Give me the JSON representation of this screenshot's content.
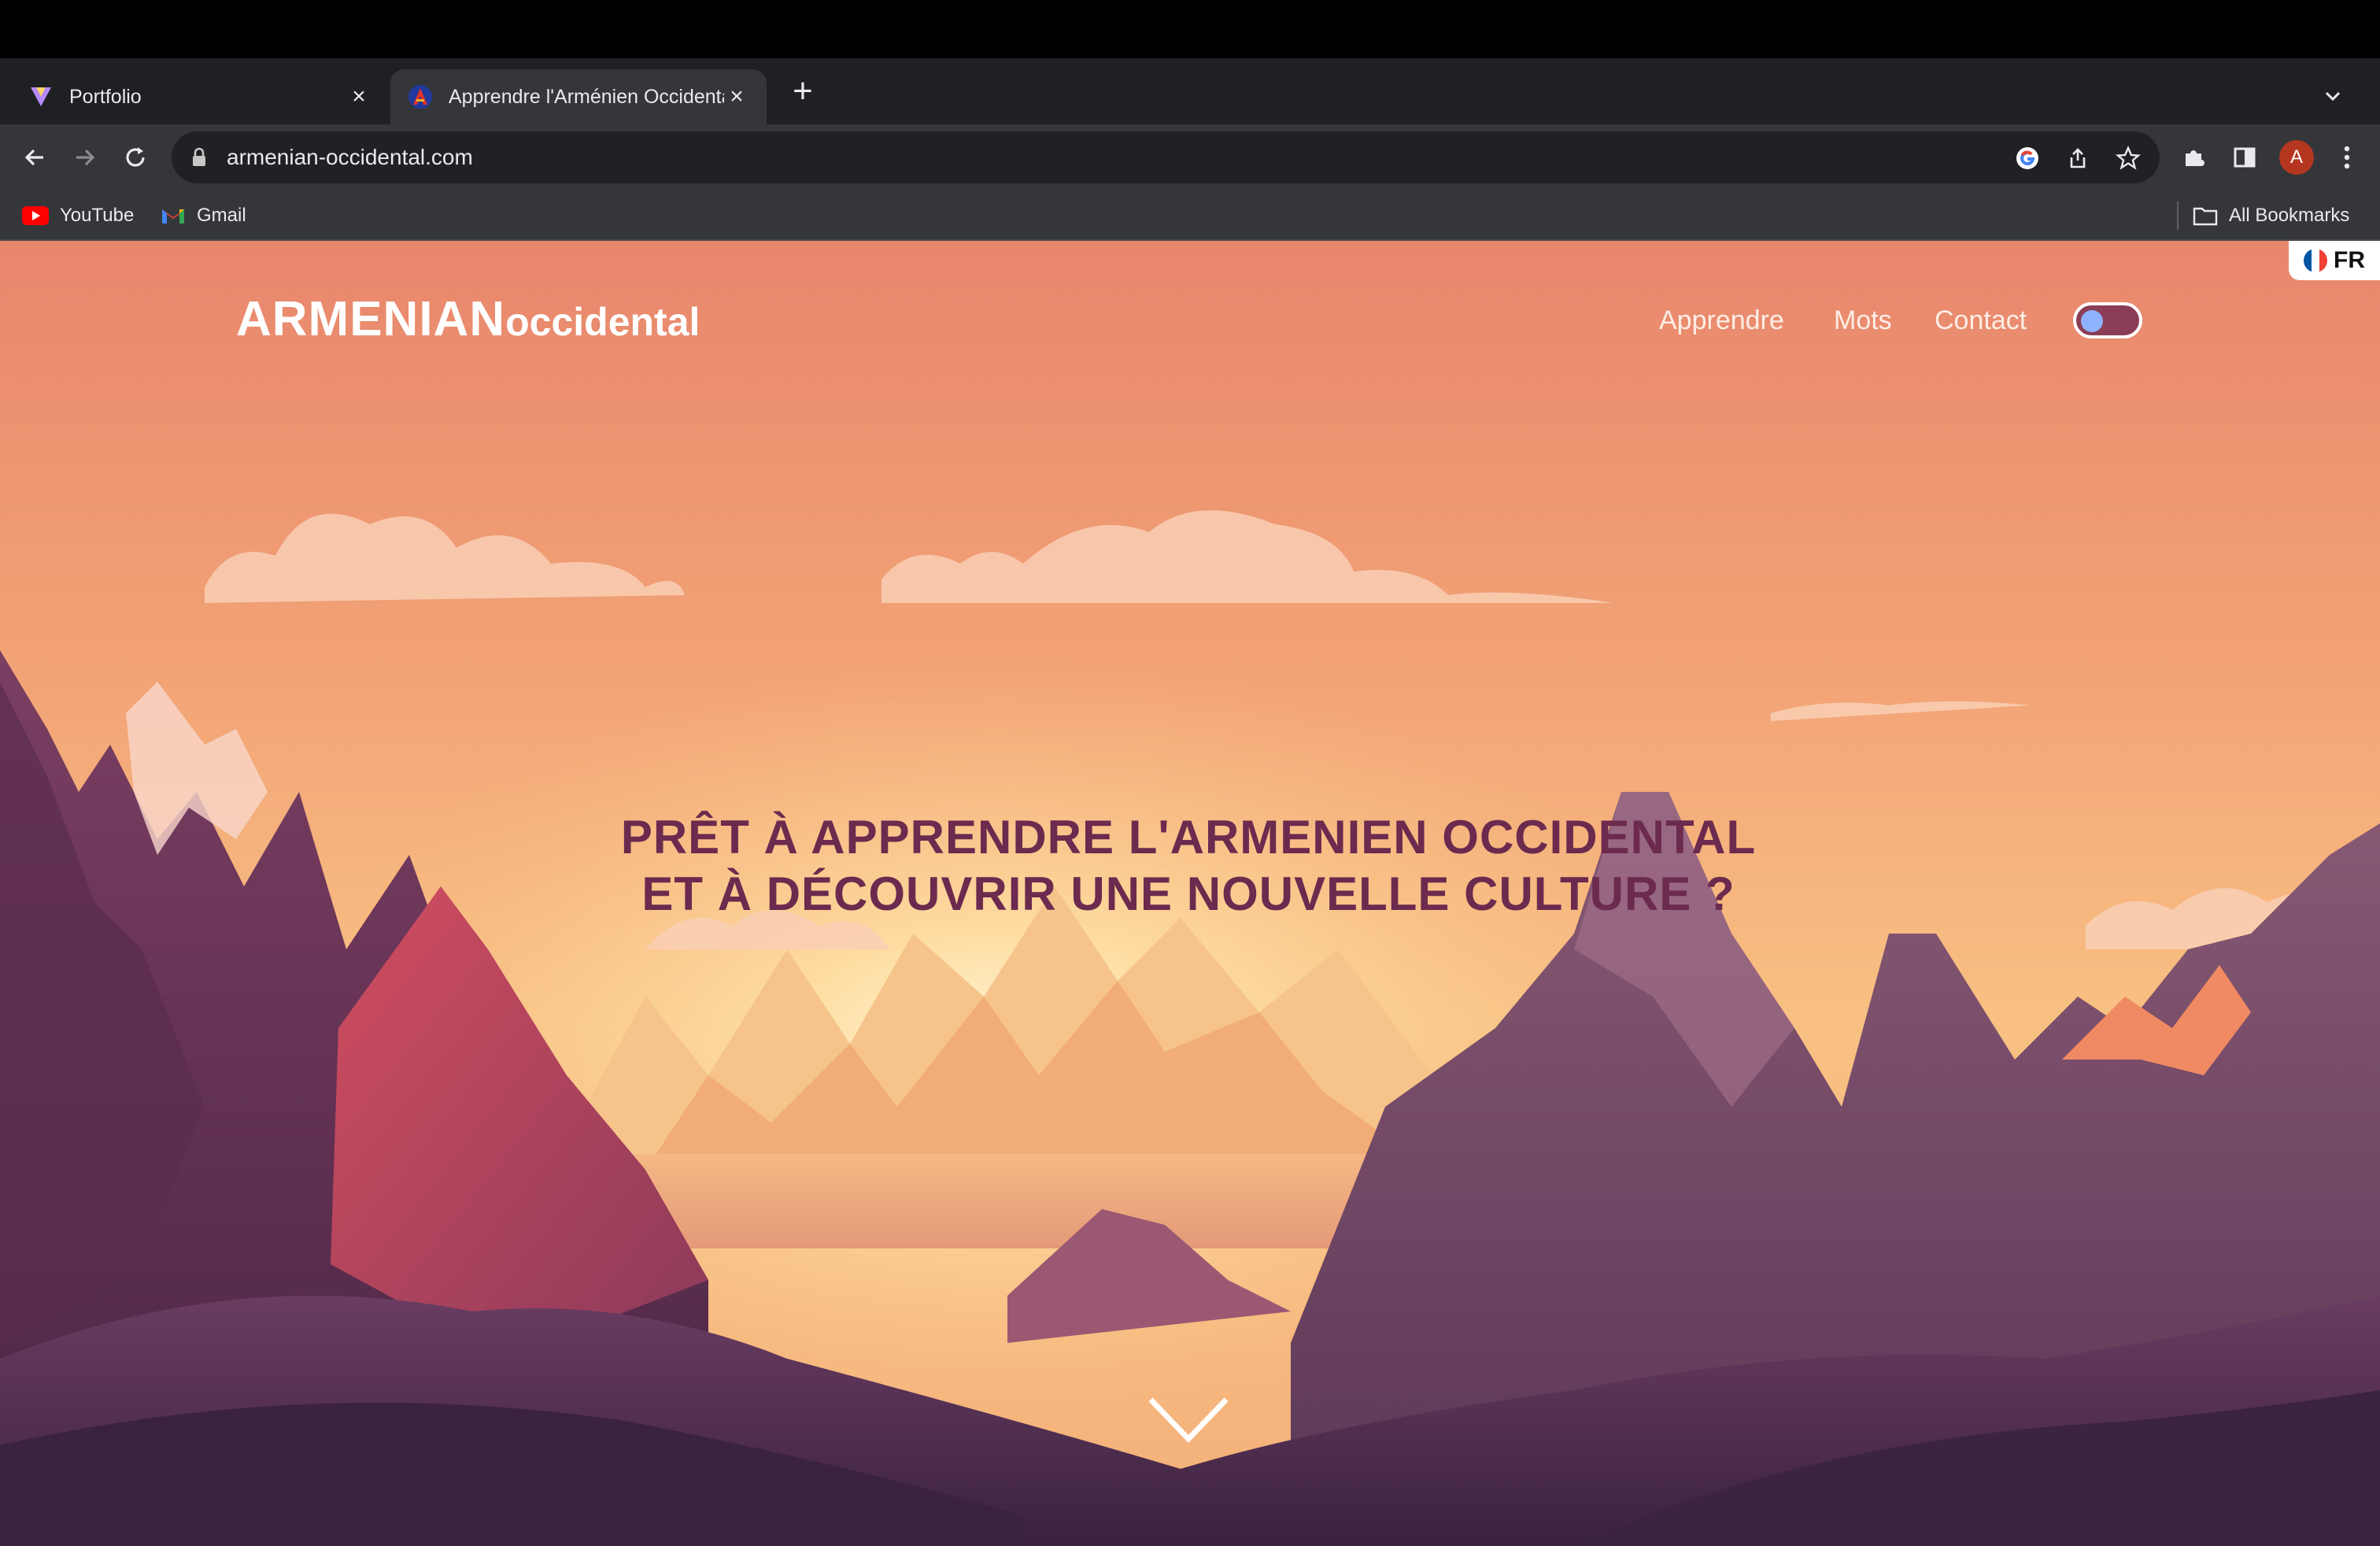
{
  "browser": {
    "tabs": [
      {
        "title": "Portfolio",
        "active": false,
        "favicon": "portfolio-v-icon"
      },
      {
        "title": "Apprendre l'Arménien Occidental",
        "active": true,
        "favicon": "armenian-a-icon"
      }
    ],
    "address": "armenian-occidental.com",
    "bookmarks": [
      {
        "label": "YouTube",
        "icon": "youtube-icon"
      },
      {
        "label": "Gmail",
        "icon": "gmail-icon"
      }
    ],
    "all_bookmarks": "All Bookmarks",
    "avatar_letter": "A"
  },
  "site": {
    "language": "FR",
    "logo_main": "ARMENIAN",
    "logo_sub": "occidental",
    "nav": [
      "Apprendre",
      "Mots",
      "Contact"
    ],
    "headline": "PRÊT À APPRENDRE L'ARMENIEN OCCIDENTAL ET À DÉCOUVRIR UNE NOUVELLE CULTURE ?",
    "theme_toggle": "dark-mode-toggle"
  },
  "colors": {
    "headline": "#6b2a4e",
    "sky_top": "#e8856c",
    "sky_glow": "#ffe9b5",
    "mountain_dark": "#4a2a45"
  }
}
